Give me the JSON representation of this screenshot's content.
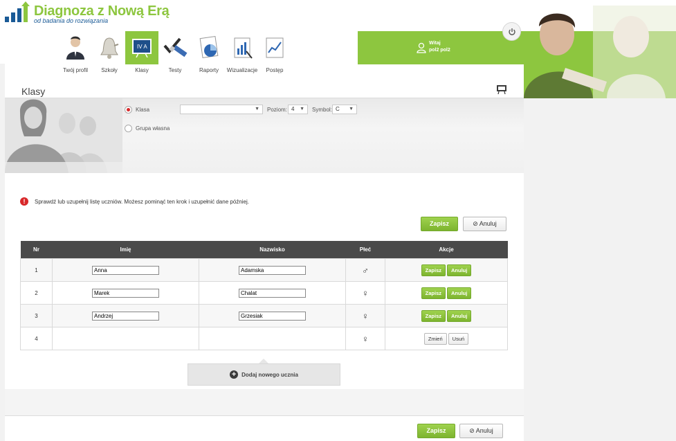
{
  "header": {
    "title": "Diagnoza z Nową Erą",
    "subtitle": "od badania do rozwiązania",
    "welcome_line1": "Witaj",
    "welcome_line2": "pol2 pol2"
  },
  "nav": [
    {
      "label": "Twój profil",
      "icon": "user-profile-icon"
    },
    {
      "label": "Szkoły",
      "icon": "bell-icon"
    },
    {
      "label": "Klasy",
      "icon": "class-board-icon",
      "active": true
    },
    {
      "label": "Testy",
      "icon": "test-check-icon"
    },
    {
      "label": "Raporty",
      "icon": "report-pie-icon"
    },
    {
      "label": "Wizualizacje",
      "icon": "visualization-icon"
    },
    {
      "label": "Postęp",
      "icon": "progress-chart-icon"
    }
  ],
  "page": {
    "title": "Klasy"
  },
  "filters": {
    "radio_klasa": "Klasa",
    "radio_grupa": "Grupa własna",
    "class_select_value": "",
    "poziom_label": "Poziom:",
    "poziom_value": "4",
    "symbol_label": "Symbol:",
    "symbol_value": "C"
  },
  "message": "Sprawdź lub uzupełnij listę uczniów. Możesz pominąć ten krok i uzupełnić dane później.",
  "buttons": {
    "save": "Zapisz",
    "cancel": "Anuluj",
    "change": "Zmień",
    "delete": "Usuń",
    "add_student": "Dodaj nowego ucznia"
  },
  "table": {
    "headers": [
      "Nr",
      "Imię",
      "Nazwisko",
      "Płeć",
      "Akcje"
    ],
    "rows": [
      {
        "nr": "1",
        "first": "Anna",
        "last": "Adamska",
        "gender": "♂",
        "mode": "edit"
      },
      {
        "nr": "2",
        "first": "Marek",
        "last": "Chalat",
        "gender": "♀",
        "mode": "edit"
      },
      {
        "nr": "3",
        "first": "Andrzej",
        "last": "Grzesiak",
        "gender": "♀",
        "mode": "edit"
      },
      {
        "nr": "4",
        "first": "",
        "last": "",
        "gender": "♀",
        "mode": "view"
      }
    ]
  },
  "colors": {
    "accent": "#8dc63f",
    "header_dark": "#4a4a4a",
    "alert": "#d8282a",
    "brand_blue": "#1a5a96"
  }
}
